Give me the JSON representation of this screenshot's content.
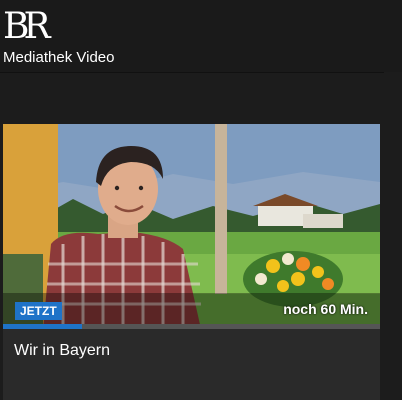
{
  "header": {
    "logo_text": "BR",
    "subtitle": "Mediathek Video"
  },
  "live_card": {
    "badge": "JETZT",
    "remaining": "noch 60 Min.",
    "title": "Wir in Bayern",
    "progress_fraction": 0.21,
    "accent_color": "#1f73c8"
  }
}
